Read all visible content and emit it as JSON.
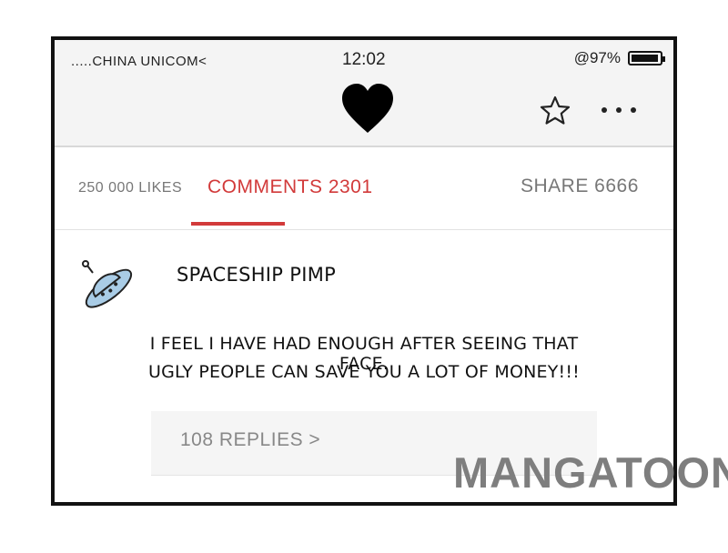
{
  "status_bar": {
    "carrier": ".....CHINA UNICOM<",
    "time": "12:02",
    "battery_text": "@97%",
    "battery_level": 0.97
  },
  "header": {
    "icons": [
      "heart-icon",
      "star-icon",
      "more-icon"
    ]
  },
  "tabs": {
    "likes": "250 000 LIKES",
    "comments": "COMMENTS 2301",
    "share": "SHARE 6666",
    "active": "comments"
  },
  "comment": {
    "author": "SPACESHIP PIMP",
    "avatar_icon": "spaceship-avatar",
    "body_lines": [
      "I FEEL I HAVE HAD ENOUGH AFTER SEEING THAT FACE.",
      "UGLY PEOPLE CAN SAVE YOU A LOT OF MONEY!!!"
    ],
    "replies": "108 REPLIES >"
  },
  "watermark": "MANGATOON",
  "colors": {
    "accent": "#d23a3a",
    "muted": "#777777"
  }
}
